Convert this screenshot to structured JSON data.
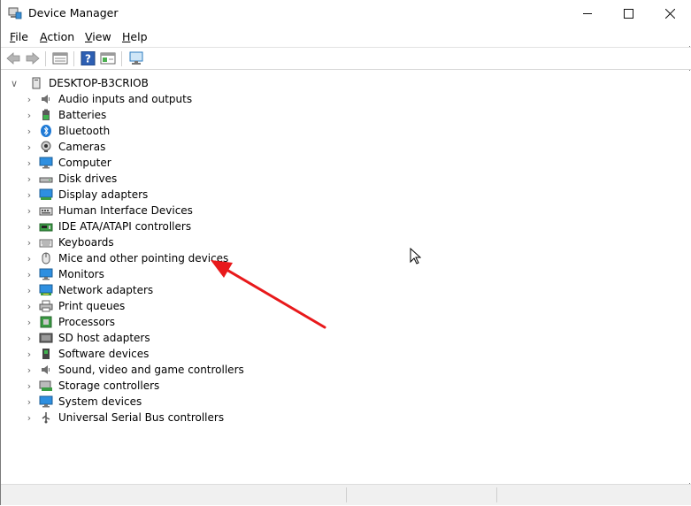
{
  "window": {
    "title": "Device Manager"
  },
  "menu": [
    "File",
    "Action",
    "View",
    "Help"
  ],
  "menu_underline": [
    "F",
    "A",
    "V",
    "H"
  ],
  "toolbar": {
    "buttons": [
      "back-icon",
      "forward-icon",
      "properties-icon",
      "help-icon",
      "action-icon",
      "monitor-scan-icon"
    ]
  },
  "tree": {
    "root": "DESKTOP-B3CRIOB",
    "items": [
      {
        "label": "Audio inputs and outputs",
        "icon": "speaker-icon"
      },
      {
        "label": "Batteries",
        "icon": "battery-icon"
      },
      {
        "label": "Bluetooth",
        "icon": "bluetooth-icon"
      },
      {
        "label": "Cameras",
        "icon": "camera-icon"
      },
      {
        "label": "Computer",
        "icon": "computer-icon"
      },
      {
        "label": "Disk drives",
        "icon": "disk-drive-icon"
      },
      {
        "label": "Display adapters",
        "icon": "display-adapter-icon"
      },
      {
        "label": "Human Interface Devices",
        "icon": "hid-icon"
      },
      {
        "label": "IDE ATA/ATAPI controllers",
        "icon": "ide-controller-icon"
      },
      {
        "label": "Keyboards",
        "icon": "keyboard-icon"
      },
      {
        "label": "Mice and other pointing devices",
        "icon": "mouse-icon"
      },
      {
        "label": "Monitors",
        "icon": "monitor-icon"
      },
      {
        "label": "Network adapters",
        "icon": "network-adapter-icon"
      },
      {
        "label": "Print queues",
        "icon": "printer-icon"
      },
      {
        "label": "Processors",
        "icon": "processor-icon"
      },
      {
        "label": "SD host adapters",
        "icon": "sd-adapter-icon"
      },
      {
        "label": "Software devices",
        "icon": "software-device-icon"
      },
      {
        "label": "Sound, video and game controllers",
        "icon": "sound-controller-icon"
      },
      {
        "label": "Storage controllers",
        "icon": "storage-controller-icon"
      },
      {
        "label": "System devices",
        "icon": "system-device-icon"
      },
      {
        "label": "Universal Serial Bus controllers",
        "icon": "usb-icon"
      }
    ]
  },
  "annotation": {
    "color": "#e8191b"
  }
}
